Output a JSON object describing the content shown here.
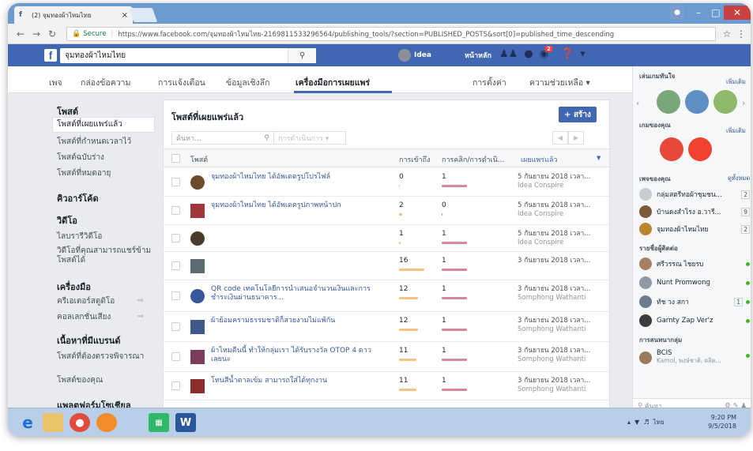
{
  "browser": {
    "tab_title": "(2) จุมทองผ้าไหมไทย",
    "secure_label": "Secure",
    "url": "https://www.facebook.com/จุมทองผ้าไหมไทย-2169811533296564/publishing_tools/?section=PUBLISHED_POSTS&sort[0]=published_time_descending"
  },
  "fb_header": {
    "search_value": "จุมทองผ้าไหมไทย",
    "profile_name": "Idea",
    "home_label": "หน้าหลัก",
    "notification_count": "2"
  },
  "page_nav": {
    "items": [
      "เพจ",
      "กล่องข้อความ",
      "การแจ้งเตือน",
      "ข้อมูลเชิงลึก",
      "เครื่องมือการเผยแพร่"
    ],
    "settings": "การตั้งค่า",
    "help": "ความช่วยเหลือ ▾"
  },
  "left_menu": {
    "posts_heading": "โพสต์",
    "posts_items": [
      "โพสต์ที่เผยแพร่แล้ว",
      "โพสต์ที่กำหนดเวลาไว้",
      "โพสต์ฉบับร่าง",
      "โพสต์ที่หมดอายุ"
    ],
    "audience_heading": "คิวอาร์โค้ด",
    "video_heading": "วิดีโอ",
    "video_items": [
      "ไลบรารีวิดีโอ",
      "วิดีโอที่คุณสามารถแชร์ข้ามโพสต์ได้"
    ],
    "tools_heading": "เครื่องมือ",
    "tools_items": [
      "ครีเอเตอร์สตูดิโอ",
      "คอลเลกชั่นเสียง"
    ],
    "brand_heading": "เนื้อหาที่มีแบรนด์",
    "brand_items": [
      "โพสต์ที่ต้องตรวจพิจารณา",
      "โพสต์ของคุณ"
    ],
    "platform_heading": "แพลตฟอร์มโซเชียล"
  },
  "main": {
    "title": "โพสต์ที่เผยแพร่แล้ว",
    "create_label": "+ สร้าง",
    "search_placeholder": "ค้นหา...",
    "action_label": "การดำเนินการ ▾",
    "columns": {
      "post": "โพสต์",
      "reach": "การเข้าถึง",
      "engagement": "การคลิก/การดำเนิ...",
      "published": "เผยแพร่แล้ว"
    },
    "rows": [
      {
        "text": "จุมทองผ้าไหมไทย ได้อัพเดตรูปโปรไฟล์",
        "reach": "0",
        "engagement": "1",
        "date": "5 กันยายน 2018 เวลา...",
        "author": "Idea Conspire",
        "reach_fill": 0.02,
        "eng_fill": 1.0
      },
      {
        "text": "จุมทองผ้าไหมไทย ได้อัพเดตรูปภาพหน้าปก",
        "reach": "2",
        "engagement": "0",
        "date": "5 กันยายน 2018 เวลา...",
        "author": "Idea Conspire",
        "reach_fill": 0.12,
        "eng_fill": 0.02
      },
      {
        "text": "",
        "reach": "1",
        "engagement": "1",
        "date": "5 กันยายน 2018 เวลา...",
        "author": "Idea Conspire",
        "reach_fill": 0.06,
        "eng_fill": 1.0
      },
      {
        "text": "",
        "reach": "16",
        "engagement": "1",
        "date": "3 กันยายน 2018 เวลา...",
        "author": "",
        "reach_fill": 1.0,
        "eng_fill": 1.0
      },
      {
        "text": "QR code เทคโนโลยีการนำเสนอจำนวนเงินและการชำระเงินผ่านธนาคาร...",
        "reach": "12",
        "engagement": "1",
        "date": "3 กันยายน 2018 เวลา...",
        "author": "Somphong Wathanti",
        "reach_fill": 0.75,
        "eng_fill": 1.0
      },
      {
        "text": "ผ้าย้อมครามธรรมชาติก็สวยงามไม่แพ้กัน",
        "reach": "12",
        "engagement": "1",
        "date": "3 กันยายน 2018 เวลา...",
        "author": "Somphong Wathanti",
        "reach_fill": 0.75,
        "eng_fill": 1.0
      },
      {
        "text": "ผ้าไหมดีนนี้ ทำให้กลุ่มเรา ได้รับรางวัล OTOP 4 ดาวเลยนะ",
        "reach": "11",
        "engagement": "1",
        "date": "3 กันยายน 2018 เวลา...",
        "author": "Somphong Wathanti",
        "reach_fill": 0.69,
        "eng_fill": 1.0
      },
      {
        "text": "โทนสีน้ำตาลเข้ม สามารถใส่ได้ทุกงาน",
        "reach": "11",
        "engagement": "1",
        "date": "3 กันยายน 2018 เวลา...",
        "author": "Somphong Wathanti",
        "reach_fill": 0.69,
        "eng_fill": 1.0
      }
    ]
  },
  "right_bar": {
    "games_heading": "เล่นเกมทันใจ",
    "games_more": "เพิ่มเติม",
    "your_games_heading": "เกมของคุณ",
    "your_games_more": "เพิ่มเติม",
    "pages_heading": "เพจของคุณ",
    "pages_all": "ดูทั้งหมด",
    "pages": [
      {
        "name": "กลุ่มสตรีทอผ้าชุมชน...",
        "count": "2"
      },
      {
        "name": "บ้านดงสำโรง อ.วารี...",
        "count": "9"
      },
      {
        "name": "จุมทองผ้าไหมไทย",
        "count": "2"
      }
    ],
    "contacts_heading": "รายชื่อผู้ติดต่อ",
    "contacts": [
      {
        "name": "ศรีวรรณ ไชยรบ",
        "extra": ""
      },
      {
        "name": "Nunt Promwong",
        "extra": ""
      },
      {
        "name": "ทัช วง สกา",
        "extra": "1"
      },
      {
        "name": "Garnty Zap Ver'z",
        "extra": ""
      }
    ],
    "groups_heading": "การสนทนากลุ่ม",
    "group_name": "BCIS",
    "group_sub": "Kamol, พงษ์ชาติ, ผลิต...",
    "search_placeholder": "ค้นหา"
  },
  "taskbar": {
    "lang": "ไทย",
    "time": "9:20 PM",
    "date": "9/5/2018"
  },
  "colors": {
    "fb_blue": "#4267b2",
    "reach_bar": "#f7c282",
    "engagement_bar": "#d6889b",
    "link": "#365899"
  }
}
